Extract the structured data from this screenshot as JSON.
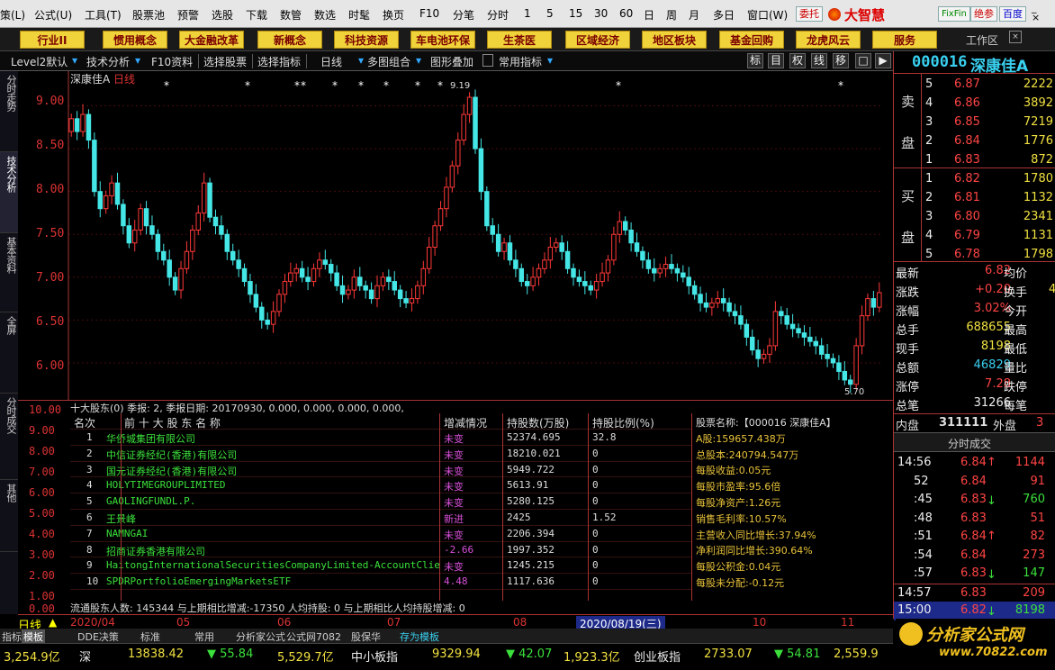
{
  "menu": [
    "策(L)",
    "公式(U)",
    "工具(T)",
    "股票池",
    "预警",
    "选股",
    "下载",
    "数管",
    "数选",
    "时髦",
    "换页",
    "F10",
    "分笔",
    "分时",
    "1",
    "5",
    "15",
    "30",
    "60",
    "日",
    "周",
    "月",
    "多日",
    "窗口(W)"
  ],
  "menu_right": {
    "btn1": "委托",
    "brand": "大智慧",
    "btn2": "FixFin",
    "btn3": "绝参",
    "btn4": "百度",
    "min": "_",
    "max": "□",
    "close": "×"
  },
  "categories": [
    "行业II",
    "惯用概念",
    "大金融改革",
    "新概念",
    "科技资源",
    "车电池环保",
    "生茶医",
    "区域经济",
    "地区板块",
    "基金回购",
    "龙虎风云",
    "服务"
  ],
  "workspace": "工作区",
  "toolbar": {
    "items": [
      "Level2默认",
      "技术分析",
      "F10资料",
      "选择股票",
      "选择指标",
      "日线",
      "多图组合",
      "图形叠加",
      "常用指标"
    ],
    "right_btns": [
      "标",
      "目",
      "权",
      "线",
      "移",
      "□",
      "▶"
    ]
  },
  "left_tabs": [
    "分时走势",
    "技术分析",
    "基本资料",
    "全屏",
    "分时成交",
    "其他"
  ],
  "chart": {
    "title": "深康佳A",
    "period": "日线",
    "high_label": "9.19",
    "low_label": "5.70",
    "y_ticks": [
      "9.00",
      "8.50",
      "8.00",
      "7.50",
      "7.00",
      "6.50",
      "6.00"
    ]
  },
  "chart_data": {
    "type": "candlestick",
    "title": "深康佳A 日线",
    "ylim": [
      5.6,
      9.3
    ],
    "y_ticks": [
      9.0,
      8.5,
      8.0,
      7.5,
      7.0,
      6.5,
      6.0
    ],
    "high": 9.19,
    "low": 5.7,
    "x_labels": [
      "2020/04",
      "05",
      "06",
      "07",
      "08",
      "2020/08/19(三)",
      "10",
      "11"
    ],
    "close": [
      8.85,
      8.7,
      8.9,
      8.6,
      8.0,
      7.8,
      7.95,
      8.1,
      7.85,
      7.6,
      7.4,
      7.55,
      7.8,
      7.6,
      7.5,
      7.3,
      7.2,
      7.0,
      6.85,
      7.1,
      7.3,
      7.55,
      7.75,
      8.1,
      7.7,
      7.6,
      7.5,
      7.3,
      7.2,
      7.1,
      6.95,
      6.8,
      6.65,
      6.5,
      6.45,
      6.6,
      6.8,
      6.95,
      7.05,
      7.1,
      7.0,
      6.95,
      7.1,
      7.2,
      7.15,
      7.05,
      6.9,
      6.8,
      6.85,
      7.0,
      6.9,
      6.85,
      6.75,
      6.9,
      7.0,
      6.95,
      6.85,
      6.75,
      6.7,
      6.75,
      6.9,
      7.1,
      7.35,
      7.6,
      7.8,
      8.05,
      8.3,
      8.6,
      8.9,
      9.1,
      8.5,
      8.0,
      7.6,
      7.5,
      7.3,
      7.4,
      7.2,
      7.1,
      6.95,
      6.9,
      7.0,
      7.1,
      7.2,
      7.35,
      7.4,
      7.3,
      7.1,
      7.0,
      6.95,
      6.9,
      6.85,
      6.95,
      7.05,
      7.2,
      7.5,
      7.65,
      7.55,
      7.4,
      7.3,
      7.2,
      7.1,
      7.05,
      7.1,
      7.15,
      7.1,
      7.05,
      7.0,
      6.9,
      6.8,
      6.7,
      6.65,
      6.7,
      6.75,
      6.7,
      6.6,
      6.55,
      6.45,
      6.3,
      6.15,
      6.05,
      6.1,
      6.2,
      6.6,
      6.55,
      6.45,
      6.4,
      6.35,
      6.3,
      6.25,
      6.2,
      6.1,
      6.05,
      6.0,
      5.9,
      5.8,
      5.75,
      6.2,
      6.55,
      6.75,
      6.65,
      6.82
    ],
    "open": [
      8.7,
      8.85,
      8.7,
      8.9,
      8.6,
      8.0,
      7.8,
      7.95,
      8.1,
      7.85,
      7.6,
      7.4,
      7.55,
      7.8,
      7.6,
      7.5,
      7.3,
      7.2,
      7.0,
      6.85,
      7.1,
      7.3,
      7.55,
      7.75,
      8.1,
      7.7,
      7.6,
      7.5,
      7.3,
      7.2,
      7.1,
      6.95,
      6.8,
      6.65,
      6.5,
      6.45,
      6.6,
      6.8,
      6.95,
      7.05,
      7.1,
      7.0,
      6.95,
      7.1,
      7.2,
      7.15,
      7.05,
      6.9,
      6.8,
      6.85,
      7.0,
      6.9,
      6.85,
      6.75,
      6.9,
      7.0,
      6.95,
      6.85,
      6.75,
      6.7,
      6.75,
      6.9,
      7.1,
      7.35,
      7.6,
      7.8,
      8.05,
      8.3,
      8.6,
      8.9,
      9.1,
      8.5,
      8.0,
      7.6,
      7.5,
      7.3,
      7.4,
      7.2,
      7.1,
      6.95,
      6.9,
      7.0,
      7.1,
      7.2,
      7.35,
      7.4,
      7.3,
      7.1,
      7.0,
      6.95,
      6.9,
      6.85,
      6.95,
      7.05,
      7.2,
      7.5,
      7.65,
      7.55,
      7.4,
      7.3,
      7.2,
      7.1,
      7.05,
      7.1,
      7.15,
      7.1,
      7.05,
      7.0,
      6.9,
      6.8,
      6.7,
      6.65,
      6.7,
      6.75,
      6.7,
      6.6,
      6.55,
      6.45,
      6.3,
      6.15,
      6.05,
      6.1,
      6.2,
      6.6,
      6.55,
      6.45,
      6.4,
      6.35,
      6.3,
      6.25,
      6.2,
      6.1,
      6.05,
      6.0,
      5.9,
      5.8,
      5.75,
      6.2,
      6.55,
      6.75,
      6.65
    ]
  },
  "holders": {
    "info": "十大股东(0) 季报: 2, 季报日期: 20170930, 0.000, 0.000, 0.000, 0.000,",
    "y_ticks": [
      "10.00",
      "9.00",
      "8.00",
      "7.00",
      "6.00",
      "5.00",
      "4.00",
      "3.00",
      "2.00",
      "1.00",
      "0.00"
    ],
    "headers": [
      "名次",
      "前 十 大 股 东 名 称",
      "增减情况",
      "持股数(万股)",
      "持股比例(%)"
    ],
    "rows": [
      [
        "1",
        "华侨城集团有限公司",
        "未变",
        "52374.695",
        "32.8"
      ],
      [
        "2",
        "中信证券经纪(香港)有限公司",
        "未变",
        "18210.021",
        "0"
      ],
      [
        "3",
        "国元证券经纪(香港)有限公司",
        "未变",
        "5949.722",
        "0"
      ],
      [
        "4",
        "HOLYTIMEGROUPLIMITED",
        "未变",
        "5613.91",
        "0"
      ],
      [
        "5",
        "GAOLINGFUNDL.P.",
        "未变",
        "5280.125",
        "0"
      ],
      [
        "6",
        "王景峰",
        "新进",
        "2425",
        "1.52"
      ],
      [
        "7",
        "NAMNGAI",
        "未变",
        "2206.394",
        "0"
      ],
      [
        "8",
        "招商证券香港有限公司",
        "-2.66",
        "1997.352",
        "0"
      ],
      [
        "9",
        "HaitongInternationalSecuritiesCompanyLimited-AccountClient",
        "未变",
        "1245.215",
        "0"
      ],
      [
        "10",
        "SPDRPortfolioEmergingMarketsETF",
        "4.48",
        "1117.636",
        "0"
      ]
    ],
    "footer": "流通股东人数: 145344   与上期相比增减:-17350   人均持股: 0   与上期相比人均持股增减: 0"
  },
  "stockinfo": [
    "股票名称:【000016 深康佳A】",
    "A股:159657.438万",
    "总股本:240794.547万",
    "每股收益:0.05元",
    "每股市盈率:95.6倍",
    "每股净资产:1.26元",
    "销售毛利率:10.57%",
    "主营收入同比增长:37.94%",
    "净利润同比增长:390.64%",
    "每股公积金:0.04元",
    "每股未分配:-0.12元"
  ],
  "dates": {
    "period": "日线",
    "labels": [
      "2020/04",
      "05",
      "06",
      "07",
      "08",
      "2020/08/19(三)",
      "10",
      "11"
    ]
  },
  "bottom_tabs": [
    "指标",
    "模板",
    "DDE决策",
    "标准",
    "常用",
    "分析家公式",
    "公式网7082",
    "股保华",
    "存为模板"
  ],
  "status": {
    "a": "3,254.9亿",
    "b": "深",
    "c": "13838.42",
    "d": "▼ 55.84",
    "e": "5,529.7亿",
    "f": "中小板指",
    "g": "9329.94",
    "h": "▼ 42.07",
    "i": "1,923.3亿",
    "j": "创业板指",
    "k": "2733.07",
    "l": "▼ 54.81",
    "m": "2,559.9"
  },
  "quote": {
    "code": "000016",
    "name": "深康佳A",
    "sell_label": [
      "卖",
      "盘"
    ],
    "buy_label": [
      "买",
      "盘"
    ],
    "sells": [
      [
        "5",
        "6.87",
        "2222"
      ],
      [
        "4",
        "6.86",
        "3892"
      ],
      [
        "3",
        "6.85",
        "7219"
      ],
      [
        "2",
        "6.84",
        "1776"
      ],
      [
        "1",
        "6.83",
        "872"
      ]
    ],
    "buys": [
      [
        "1",
        "6.82",
        "1780"
      ],
      [
        "2",
        "6.81",
        "1132"
      ],
      [
        "3",
        "6.80",
        "2341"
      ],
      [
        "4",
        "6.79",
        "1131"
      ],
      [
        "5",
        "6.78",
        "1798"
      ]
    ],
    "stats": [
      [
        "最新",
        "6.82",
        "均价",
        ""
      ],
      [
        "涨跌",
        "+0.20",
        "换手",
        "4"
      ],
      [
        "涨幅",
        "3.02%",
        "今开",
        ""
      ],
      [
        "总手",
        "688655",
        "最高",
        ""
      ],
      [
        "现手",
        "8198",
        "最低",
        ""
      ],
      [
        "总额",
        "46829",
        "量比",
        ""
      ],
      [
        "涨停",
        "7.28",
        "跌停",
        ""
      ],
      [
        "总笔",
        "31266",
        "每笔",
        ""
      ]
    ],
    "inner": [
      "内盘",
      "311111",
      "外盘",
      "3"
    ],
    "ticks_title": "分时成交",
    "ticks": [
      [
        "14:56",
        "6.84↑",
        "1144"
      ],
      [
        "52",
        "6.84",
        "91"
      ],
      [
        ":45",
        "6.83↓",
        "760"
      ],
      [
        ":48",
        "6.83",
        "51"
      ],
      [
        ":51",
        "6.84↑",
        "82"
      ],
      [
        ":54",
        "6.84",
        "273"
      ],
      [
        ":57",
        "6.83↓",
        "147"
      ],
      [
        "14:57",
        "6.83",
        "209"
      ],
      [
        "15:00",
        "6.82↓",
        "8198"
      ]
    ]
  },
  "logo": {
    "text": "分析家公式网",
    "url": "www.70822.com"
  }
}
